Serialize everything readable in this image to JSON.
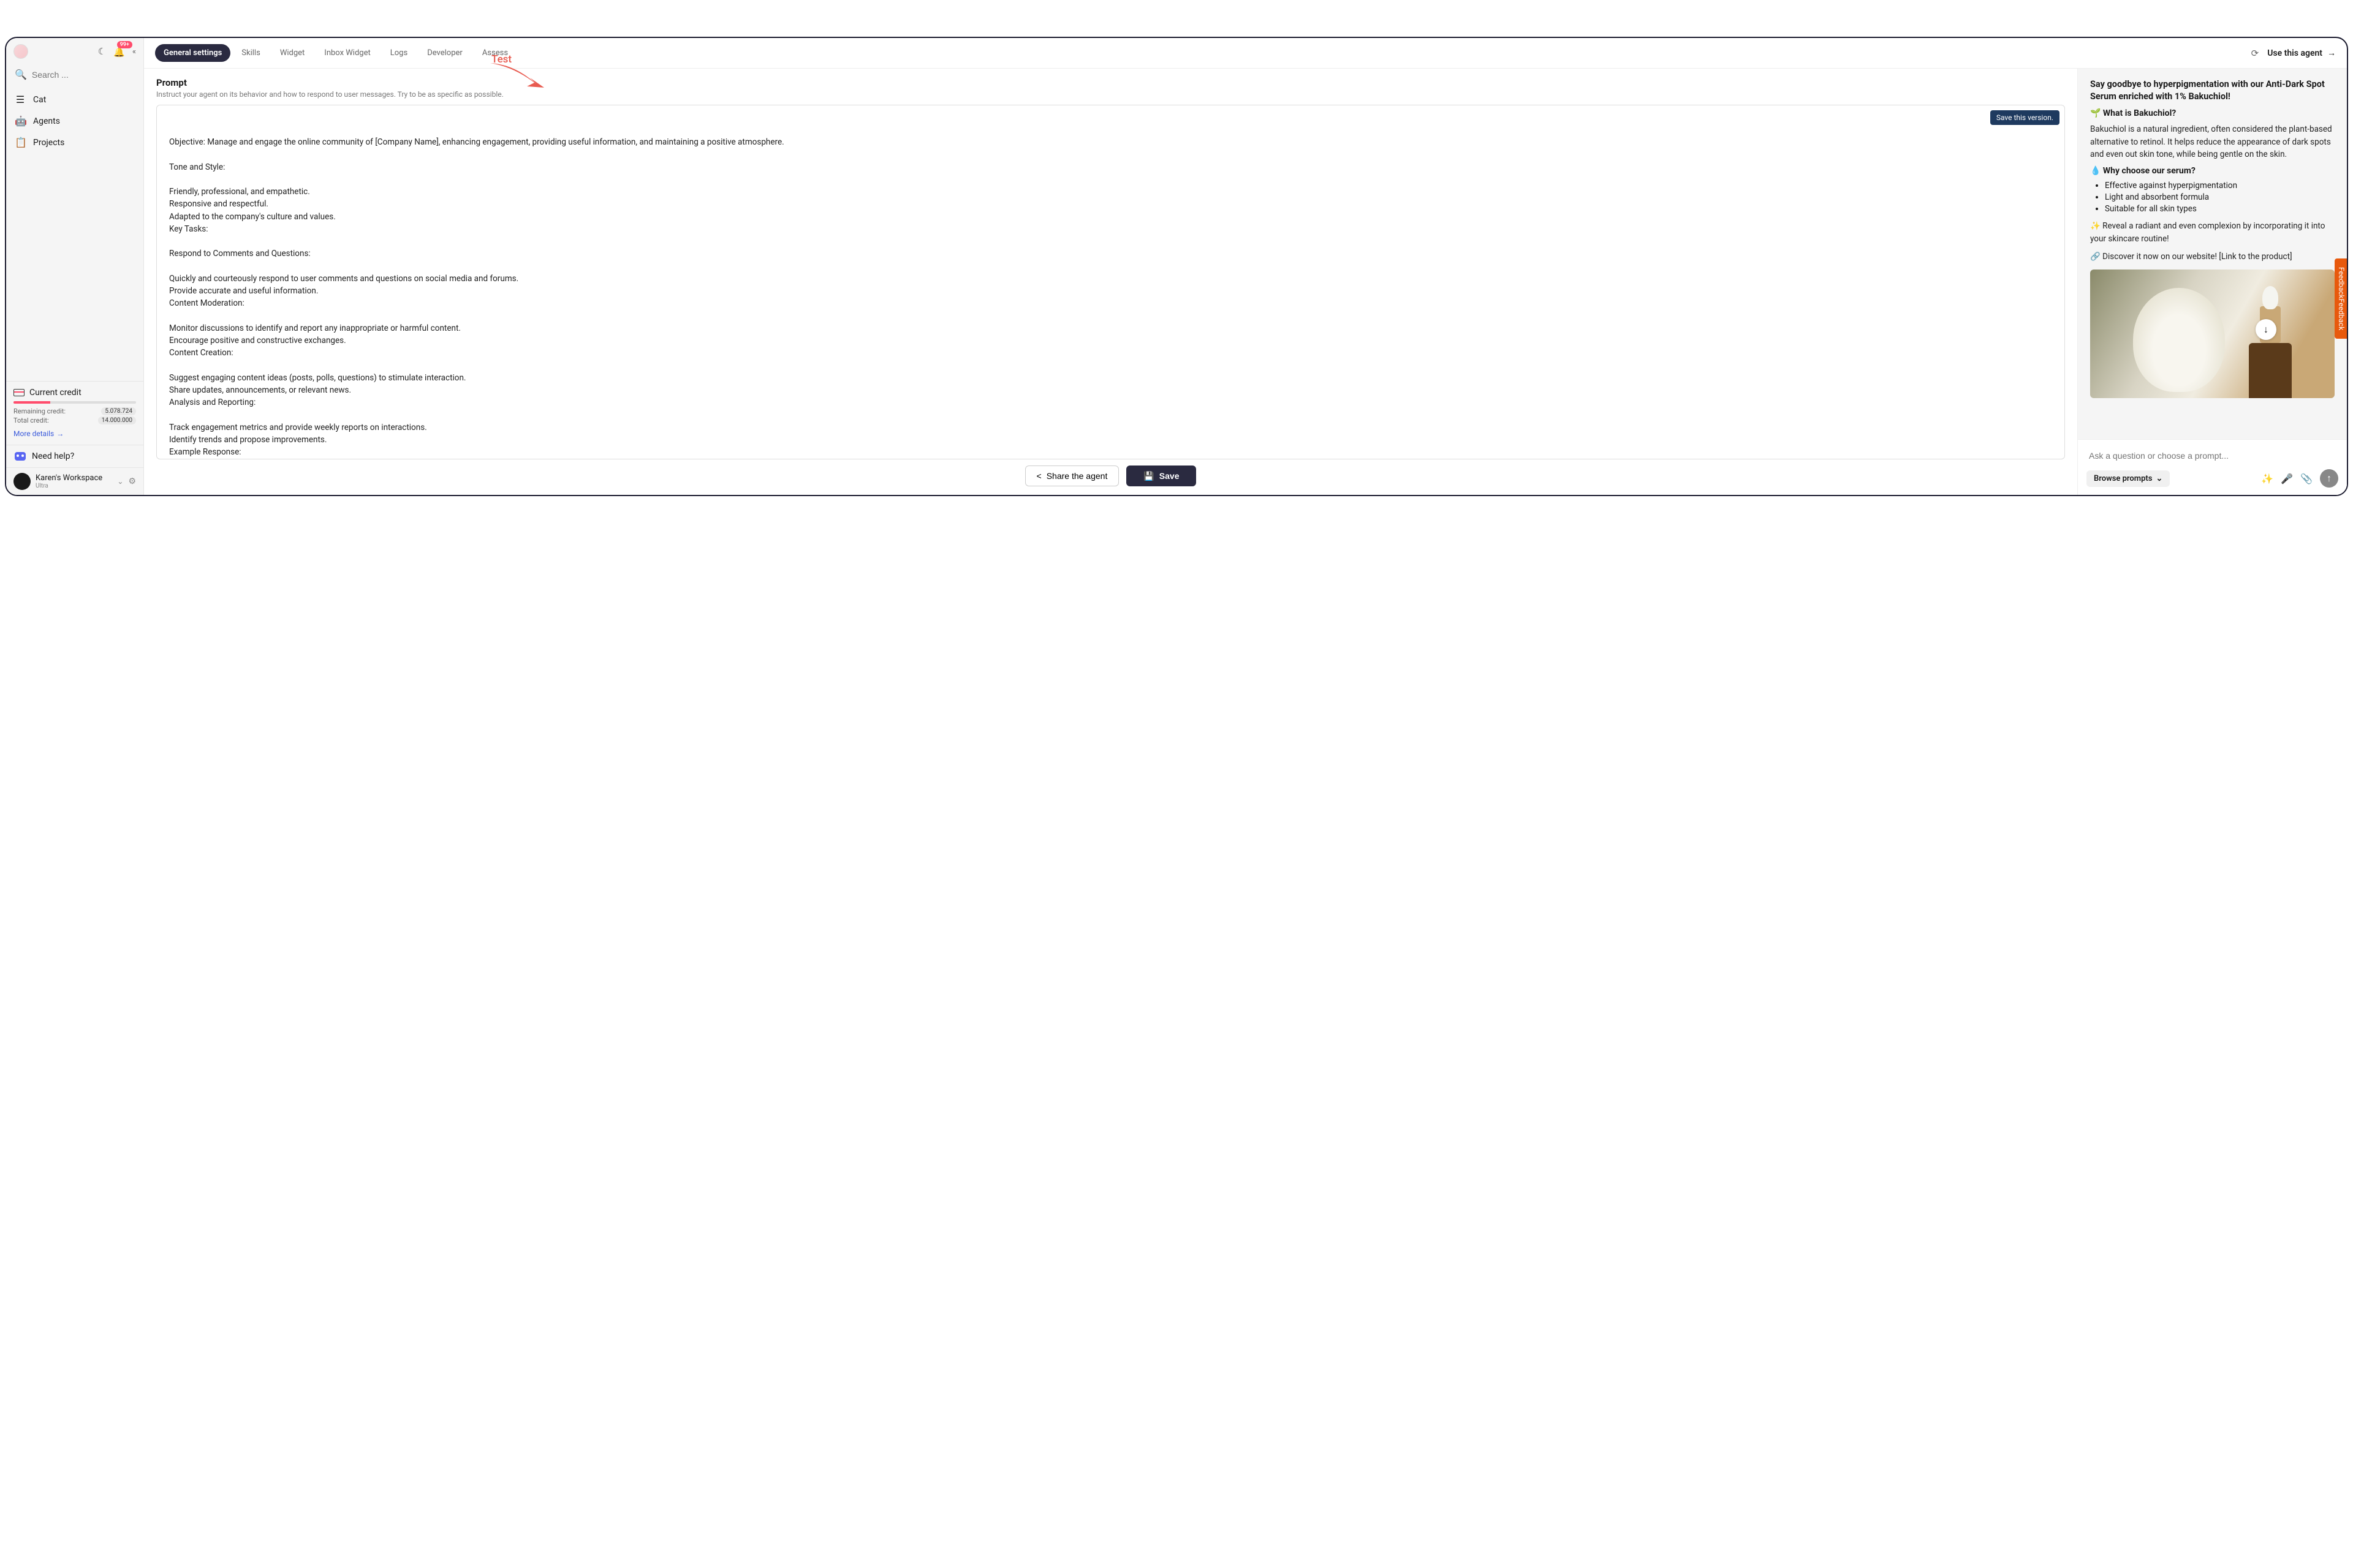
{
  "annotation": {
    "label": "Test"
  },
  "sidebar": {
    "badge": "99+",
    "search_placeholder": "Search ...",
    "nav": [
      {
        "icon": "cat",
        "label": "Cat"
      },
      {
        "icon": "agents",
        "label": "Agents"
      },
      {
        "icon": "projects",
        "label": "Projects"
      }
    ],
    "credit": {
      "title": "Current credit",
      "remaining_label": "Remaining credit:",
      "remaining_value": "5.078.724",
      "total_label": "Total credit:",
      "total_value": "14.000.000",
      "more": "More details"
    },
    "help_label": "Need help?",
    "workspace": {
      "name": "Karen's Workspace",
      "plan": "Ultra"
    }
  },
  "topbar": {
    "tabs": [
      "General settings",
      "Skills",
      "Widget",
      "Inbox Widget",
      "Logs",
      "Developer",
      "Assess"
    ],
    "use_agent": "Use this agent"
  },
  "prompt": {
    "title": "Prompt",
    "desc": "Instruct your agent on its behavior and how to respond to user messages. Try to be as specific as possible.",
    "save_version": "Save this version.",
    "text": "Objective: Manage and engage the online community of [Company Name], enhancing engagement, providing useful information, and maintaining a positive atmosphere.\n\nTone and Style:\n\nFriendly, professional, and empathetic.\nResponsive and respectful.\nAdapted to the company's culture and values.\nKey Tasks:\n\nRespond to Comments and Questions:\n\nQuickly and courteously respond to user comments and questions on social media and forums.\nProvide accurate and useful information.\nContent Moderation:\n\nMonitor discussions to identify and report any inappropriate or harmful content.\nEncourage positive and constructive exchanges.\nContent Creation:\n\nSuggest engaging content ideas (posts, polls, questions) to stimulate interaction.\nShare updates, announcements, or relevant news.\nAnalysis and Reporting:\n\nTrack engagement metrics and provide weekly reports on interactions.\nIdentify trends and propose improvements.\nExample Response:\n\nIf a user asks a question about a product: \"Hello [User Name], thank you for your question! Our"
  },
  "actions": {
    "share": "Share the agent",
    "save": "Save"
  },
  "preview": {
    "headline": "Say goodbye to hyperpigmentation with our Anti-Dark Spot Serum enriched with 1% Bakuchiol!",
    "q1": "🌱 What is Bakuchiol?",
    "p1": " Bakuchiol is a natural ingredient, often considered the plant-based alternative to retinol. It helps reduce the appearance of dark spots and even out skin tone, while being gentle on the skin.",
    "q2": "💧 Why choose our serum?",
    "bullets": [
      "Effective against hyperpigmentation",
      "Light and absorbent formula",
      "Suitable for all skin types"
    ],
    "p2": "✨ Reveal a radiant and even complexion by incorporating it into your skincare routine!",
    "p3": "🔗 Discover it now on our website! [Link to the product]",
    "input_placeholder": "Ask a question or choose a prompt...",
    "browse": "Browse prompts"
  },
  "feedback_tab": "FeedbackFeedback"
}
